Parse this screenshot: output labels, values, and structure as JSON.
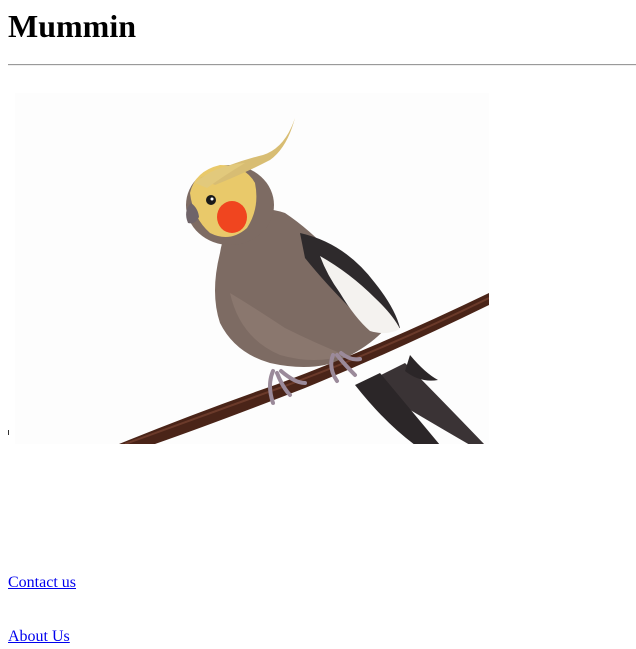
{
  "page": {
    "title": "Mummin"
  },
  "image": {
    "subject": "cockatiel perched on a branch",
    "colors": {
      "body": "#7d6b63",
      "wing_dark": "#2e2a2c",
      "wing_white": "#f4f2ef",
      "face": "#e9c96a",
      "cheek": "#f0451f",
      "branch": "#4a2418"
    }
  },
  "links": {
    "contact_label": "Contact us",
    "about_label": "About Us",
    "color": "#0000ee"
  }
}
